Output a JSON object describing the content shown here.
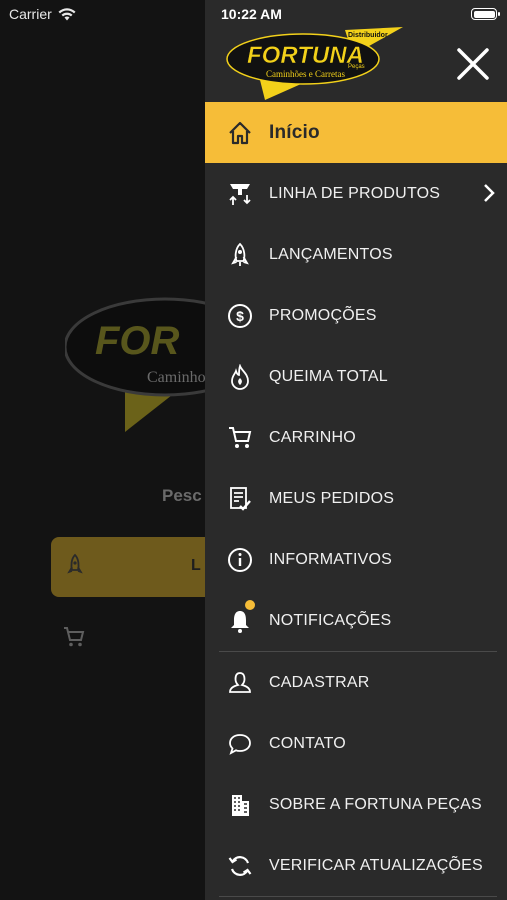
{
  "status": {
    "carrier": "Carrier",
    "time": "10:22 AM"
  },
  "background": {
    "search_partial": "Pesc",
    "card_partial": "L",
    "logo_partial": "FOR",
    "logo_sub_partial": "Caminho"
  },
  "logo": {
    "brand": "FORTUNA",
    "tag": "Distribuidor",
    "sub": "Caminhões e Carretas",
    "pecas": "Peças"
  },
  "menu": {
    "active": "Início",
    "items": [
      {
        "label": "LINHA DE PRODUTOS",
        "icon": "product-line-icon"
      },
      {
        "label": "LANÇAMENTOS",
        "icon": "rocket-icon"
      },
      {
        "label": "PROMOÇÕES",
        "icon": "dollar-circle-icon"
      },
      {
        "label": "QUEIMA TOTAL",
        "icon": "fire-icon"
      },
      {
        "label": "CARRINHO",
        "icon": "cart-icon"
      },
      {
        "label": "MEUS PEDIDOS",
        "icon": "orders-icon"
      },
      {
        "label": "INFORMATIVOS",
        "icon": "info-icon"
      },
      {
        "label": "NOTIFICAÇÕES",
        "icon": "bell-icon"
      }
    ],
    "items2": [
      {
        "label": "CADASTRAR",
        "icon": "user-icon"
      },
      {
        "label": "CONTATO",
        "icon": "chat-bubble-icon"
      },
      {
        "label": "SOBRE A FORTUNA PEÇAS",
        "icon": "building-icon"
      },
      {
        "label": "VERIFICAR ATUALIZAÇÕES",
        "icon": "refresh-icon"
      }
    ]
  },
  "colors": {
    "accent": "#f6bd38",
    "drawer_bg": "#2a2a2a"
  }
}
